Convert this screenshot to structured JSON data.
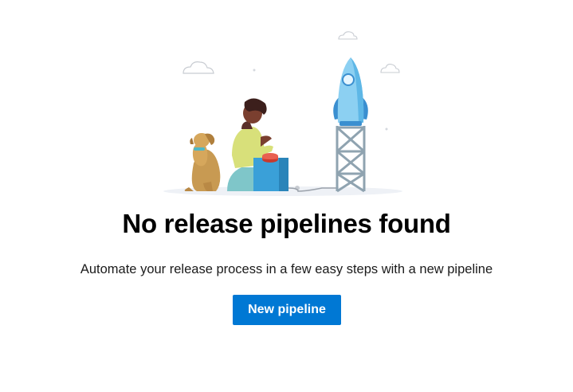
{
  "empty_state": {
    "title": "No release pipelines found",
    "description": "Automate your release process in a few easy steps with a new pipeline",
    "illustration": "person-dog-rocket-launch-illustration"
  },
  "actions": {
    "new_pipeline_label": "New pipeline"
  },
  "colors": {
    "accent": "#0078d4",
    "button_text": "#ffffff",
    "title_text": "#000000"
  }
}
